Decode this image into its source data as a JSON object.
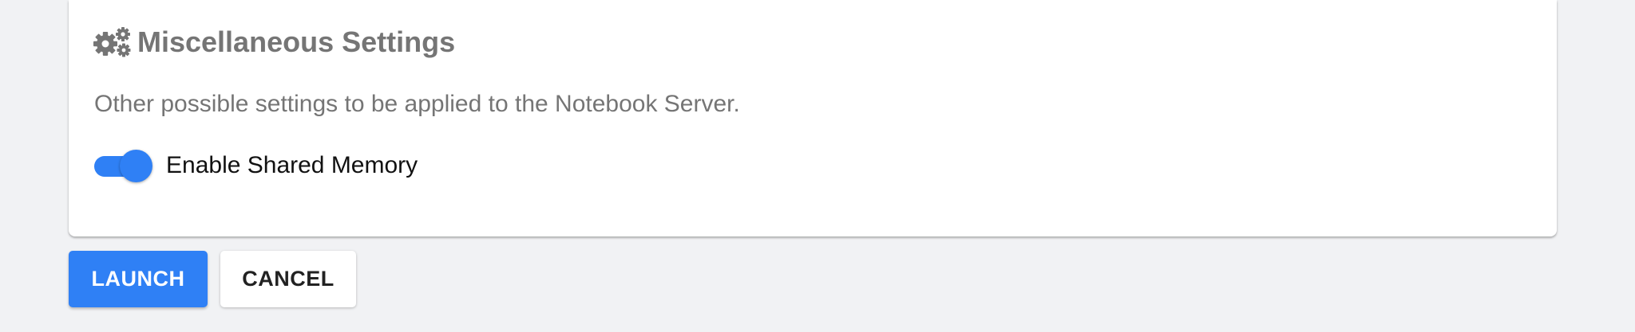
{
  "misc_settings": {
    "icon": "gears-icon",
    "title": "Miscellaneous Settings",
    "description": "Other possible settings to be applied to the Notebook Server.",
    "shared_memory_toggle": {
      "label": "Enable Shared Memory",
      "checked": true
    }
  },
  "actions": {
    "launch_label": "LAUNCH",
    "cancel_label": "CANCEL"
  },
  "colors": {
    "accent": "#2f80f5",
    "title_gray": "#757575",
    "background": "#f1f2f4",
    "card": "#ffffff"
  }
}
